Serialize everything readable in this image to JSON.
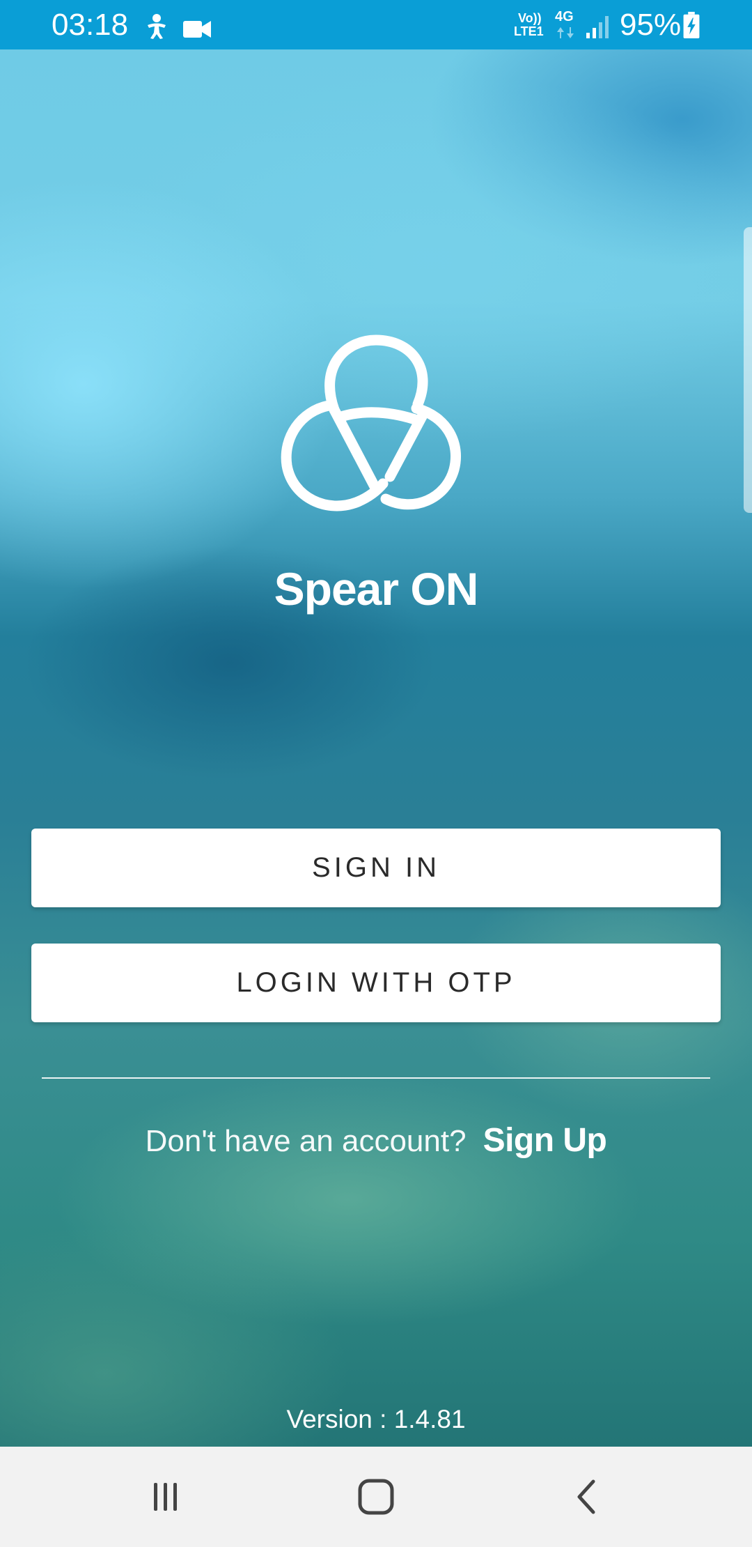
{
  "status_bar": {
    "time": "03:18",
    "network_top": "Vo))",
    "network_bottom": "LTE1",
    "network_type": "4G",
    "battery": "95%",
    "icons": [
      "accessibility-icon",
      "video-camera-icon",
      "volte-icon",
      "data-4g-icon",
      "signal-icon",
      "battery-charging-icon"
    ]
  },
  "app": {
    "name": "Spear ON",
    "logo": "trefoil-knot-logo"
  },
  "actions": {
    "sign_in_label": "SIGN IN",
    "otp_label": "LOGIN WITH OTP"
  },
  "account": {
    "prompt": "Don't have an account?",
    "sign_up_label": "Sign Up"
  },
  "version": "Version : 1.4.81",
  "nav_bar": {
    "buttons": [
      "recent-apps-icon",
      "home-icon",
      "back-icon"
    ]
  },
  "colors": {
    "status_bar": "#0a9ed6",
    "button_bg": "#ffffff",
    "button_text": "#2a2a2a",
    "nav_bar": "#f2f2f2"
  }
}
